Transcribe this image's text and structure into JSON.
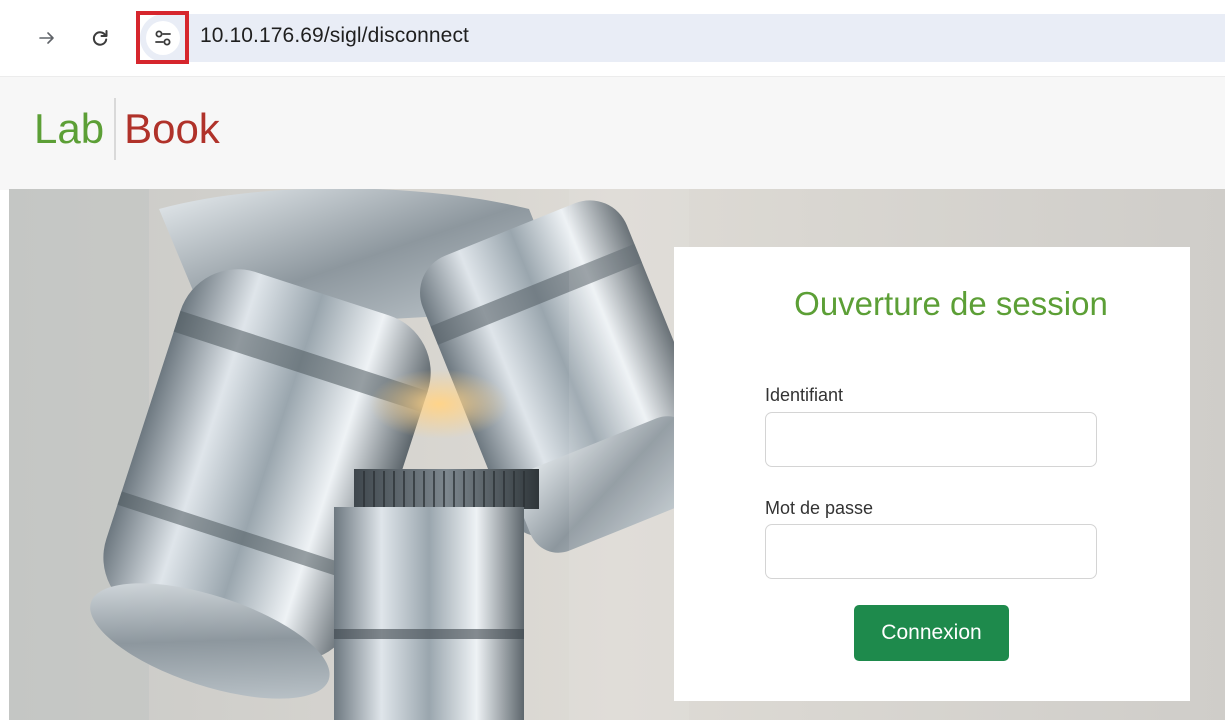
{
  "browser": {
    "url": "10.10.176.69/sigl/disconnect",
    "icons": {
      "forward": "arrow-forward-icon",
      "reload": "reload-icon",
      "site_info": "site-settings-icon"
    },
    "highlight_color": "#d6262d"
  },
  "header": {
    "logo_left": "Lab",
    "logo_right": "Book",
    "brand_green": "#5c9f36",
    "brand_red": "#b0322a"
  },
  "login": {
    "title": "Ouverture de session",
    "username_label": "Identifiant",
    "username_value": "",
    "password_label": "Mot de passe",
    "password_value": "",
    "submit_label": "Connexion",
    "button_color": "#1e8a4c"
  }
}
